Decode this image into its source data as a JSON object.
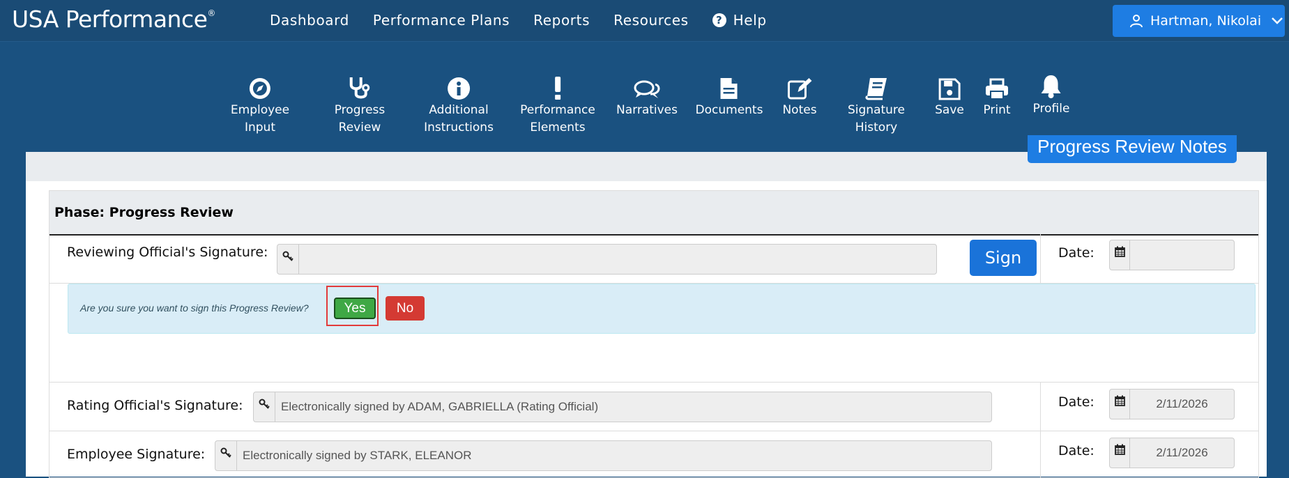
{
  "header": {
    "brand": "USA Performance",
    "brand_mark": "®",
    "nav": [
      "Dashboard",
      "Performance Plans",
      "Reports",
      "Resources",
      "Help"
    ],
    "user_name": "Hartman, Nikolai"
  },
  "toolbar": {
    "employee_input": [
      "Employee",
      "Input"
    ],
    "progress_review": [
      "Progress",
      "Review"
    ],
    "additional_instructions": [
      "Additional",
      "Instructions"
    ],
    "performance_elements": [
      "Performance",
      "Elements"
    ],
    "narratives": "Narratives",
    "documents": "Documents",
    "notes": "Notes",
    "signature_history": [
      "Signature",
      "History"
    ],
    "save": "Save",
    "print": "Print",
    "profile": "Profile"
  },
  "notes_button": "Progress Review Notes",
  "phase": {
    "title": "Phase: Progress Review",
    "reviewing_label": "Reviewing Official's Signature:",
    "reviewing_value": "",
    "sign_label": "Sign",
    "date_label": "Date:",
    "reviewing_date": "",
    "confirm_question": "Are you sure you want to sign this Progress Review?",
    "yes_label": "Yes",
    "no_label": "No",
    "rating_label": "Rating Official's Signature:",
    "rating_value": "Electronically signed by ADAM, GABRIELLA (Rating Official)",
    "rating_date": "2/11/2026",
    "employee_label": "Employee Signature:",
    "employee_value": "Electronically signed by STARK, ELEANOR",
    "employee_date": "2/11/2026"
  },
  "colors": {
    "header_bg": "#1a4b75",
    "toolbar_bg": "#1a5180",
    "primary": "#1e7de3",
    "yes": "#3fa845",
    "no": "#d43a33",
    "alert_bg": "#d9edf7"
  }
}
